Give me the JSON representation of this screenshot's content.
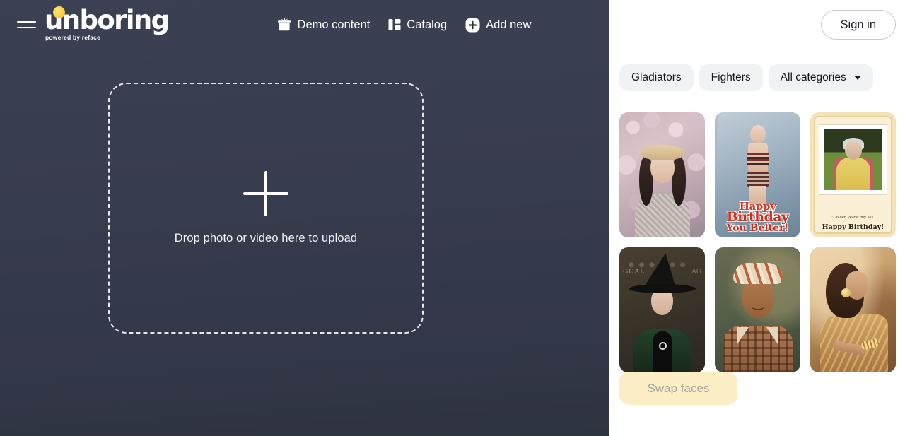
{
  "colors": {
    "editor_bg": "#373c4e",
    "catalog_bg": "#ffffff",
    "logo_accent": "#fdd34a",
    "chip_bg": "#f1f2f4",
    "swap_bg": "#fbeec4",
    "swap_text": "#a9a49a"
  },
  "header": {
    "menu_icon": "hamburger-icon",
    "logo_word": "unboring",
    "logo_tagline": "powered by reface",
    "nav": [
      {
        "label": "Demo content",
        "icon": "gift-icon"
      },
      {
        "label": "Catalog",
        "icon": "layout-grid-icon"
      },
      {
        "label": "Add new",
        "icon": "plus-circle-icon"
      }
    ],
    "sign_in_label": "Sign in"
  },
  "editor": {
    "dropzone": {
      "icon": "plus-icon",
      "label": "Drop photo or video here to upload"
    }
  },
  "catalog": {
    "chips": [
      {
        "label": "Gladiators",
        "has_caret": false
      },
      {
        "label": "Fighters",
        "has_caret": false
      },
      {
        "label": "All categories",
        "has_caret": true
      }
    ],
    "cards": [
      {
        "id": "card-1",
        "alt": "Woman in straw hat among pink cherry blossoms"
      },
      {
        "id": "card-2",
        "alt": "Happy Birthday You Belter! greeting with woman on icy background",
        "text_lines": [
          "Happy",
          "Birthday",
          "You Belter!"
        ]
      },
      {
        "id": "card-3",
        "alt": "Cream greeting card with framed photo of elderly woman",
        "caption_small": "\"Golden years\" my ass.",
        "caption_large": "Happy Birthday!"
      },
      {
        "id": "card-4",
        "alt": "Witch professor in pointed hat before a chalkboard",
        "chalk_left": "GOAL",
        "chalk_right": "AG"
      },
      {
        "id": "card-5",
        "alt": "Young man with patterned headwrap and plaid shirt"
      },
      {
        "id": "card-6",
        "alt": "Woman dancing in ornate golden Indian attire"
      }
    ],
    "swap_button_label": "Swap faces"
  }
}
